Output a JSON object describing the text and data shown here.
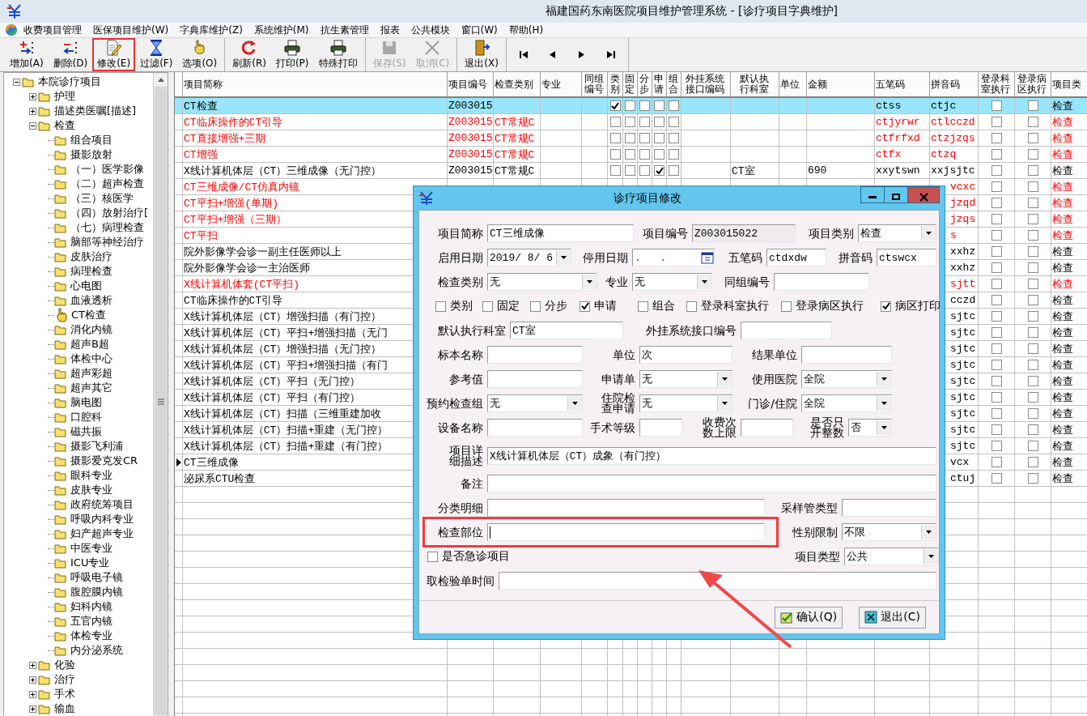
{
  "window": {
    "title": "福建国药东南医院项目维护管理系统 - [诊疗项目字典维护]"
  },
  "menu": [
    "收费项目管理",
    "医保项目维护(W)",
    "字典库维护(Z)",
    "系统维护(M)",
    "抗生素管理",
    "报表",
    "公共模块",
    "窗口(W)",
    "帮助(H)"
  ],
  "toolbar": {
    "groups": [
      [
        {
          "label": "增加(A)",
          "disabled": false,
          "annotated": false
        },
        {
          "label": "删除(D)",
          "disabled": false,
          "annotated": false
        },
        {
          "label": "修改(E)",
          "disabled": false,
          "annotated": true
        },
        {
          "label": "过滤(F)",
          "disabled": false,
          "annotated": false
        },
        {
          "label": "选项(O)",
          "disabled": false,
          "annotated": false
        }
      ],
      [
        {
          "label": "刷新(R)",
          "disabled": false,
          "annotated": false
        },
        {
          "label": "打印(P)",
          "disabled": false,
          "annotated": false
        },
        {
          "label": "特殊打印",
          "disabled": false,
          "annotated": false
        }
      ],
      [
        {
          "label": "保存(S)",
          "disabled": true,
          "annotated": false
        },
        {
          "label": "取消(C)",
          "disabled": true,
          "annotated": false
        }
      ],
      [
        {
          "label": "退出(X)",
          "disabled": false,
          "annotated": false
        }
      ]
    ]
  },
  "tree": {
    "label": "本院诊疗项目",
    "expanded": true,
    "children": [
      {
        "label": "护理",
        "expanded": false
      },
      {
        "label": "描述类医嘱[描述]",
        "expanded": false
      },
      {
        "label": "检查",
        "expanded": true,
        "children": [
          {
            "label": "组合项目",
            "selected": false
          },
          {
            "label": "摄影放射",
            "selected": false
          },
          {
            "label": "（一）医学影像",
            "selected": false
          },
          {
            "label": "（二）超声检查",
            "selected": false
          },
          {
            "label": "（三）核医学",
            "selected": false
          },
          {
            "label": "（四）放射治疗[",
            "selected": false
          },
          {
            "label": "（七）病理检查",
            "selected": false
          },
          {
            "label": "脑部等神经治疗",
            "selected": false
          },
          {
            "label": "皮肤治疗",
            "selected": false
          },
          {
            "label": "病理检查",
            "selected": false
          },
          {
            "label": "心电图",
            "selected": false
          },
          {
            "label": "血液透析",
            "selected": false
          },
          {
            "label": "CT检查",
            "selected": true
          },
          {
            "label": "消化内镜",
            "selected": false
          },
          {
            "label": "超声B超",
            "selected": false
          },
          {
            "label": "体检中心",
            "selected": false
          },
          {
            "label": "超声彩超",
            "selected": false
          },
          {
            "label": "超声其它",
            "selected": false
          },
          {
            "label": "脑电图",
            "selected": false
          },
          {
            "label": "口腔科",
            "selected": false
          },
          {
            "label": "磁共振",
            "selected": false
          },
          {
            "label": "摄影飞利浦",
            "selected": false
          },
          {
            "label": "摄影爱克发CR",
            "selected": false
          },
          {
            "label": "眼科专业",
            "selected": false
          },
          {
            "label": "皮肤专业",
            "selected": false
          },
          {
            "label": "政府统筹项目",
            "selected": false
          },
          {
            "label": "呼吸内科专业",
            "selected": false
          },
          {
            "label": "妇产超声专业",
            "selected": false
          },
          {
            "label": "中医专业",
            "selected": false
          },
          {
            "label": "ICU专业",
            "selected": false
          },
          {
            "label": "呼吸电子镜",
            "selected": false
          },
          {
            "label": "腹腔膜内镜",
            "selected": false
          },
          {
            "label": "妇科内镜",
            "selected": false
          },
          {
            "label": "五官内镜",
            "selected": false
          },
          {
            "label": "体检专业",
            "selected": false
          },
          {
            "label": "内分泌系统",
            "selected": false
          }
        ]
      },
      {
        "label": "化验",
        "expanded": false
      },
      {
        "label": "治疗",
        "expanded": false
      },
      {
        "label": "手术",
        "expanded": false
      },
      {
        "label": "输血",
        "expanded": false
      }
    ]
  },
  "grid": {
    "columns": [
      "项目简称",
      "项目编号",
      "检查类别",
      "专业",
      "同组编号",
      "类别",
      "固定",
      "分步",
      "申请",
      "组合",
      "外挂系统接口编码",
      "默认执行科室",
      "单位",
      "金额",
      "五笔码",
      "拼音码",
      "登录科室执行",
      "登录病区执行",
      "项目类"
    ],
    "rows": [
      {
        "name": "CT检查",
        "code": "Z003015",
        "flags": [
          true,
          false,
          false,
          false,
          false
        ],
        "wubi": "ctss",
        "pinyin": "ctjc",
        "dept_exec": false,
        "ward_exec": false,
        "category": "检查",
        "emphasized": false,
        "selected": true,
        "current": false
      },
      {
        "name": "CT临床操作的CT引导",
        "code": "Z003015",
        "exam_type": "CT常规C",
        "flags": [
          false,
          false,
          false,
          false,
          false
        ],
        "wubi": "ctjyrwr",
        "pinyin": "ctlcczd",
        "dept_exec": false,
        "ward_exec": false,
        "category": "检查",
        "emphasized": true,
        "selected": false,
        "current": false
      },
      {
        "name": "CT直接增强+三期",
        "code": "Z003015",
        "exam_type": "CT常规C",
        "flags": [
          false,
          false,
          false,
          false,
          false
        ],
        "wubi": "ctfrfxd",
        "pinyin": "ctzjzqs",
        "dept_exec": false,
        "ward_exec": false,
        "category": "检查",
        "emphasized": true,
        "selected": false,
        "current": false
      },
      {
        "name": "CT增强",
        "code": "Z003015",
        "exam_type": "CT常规C",
        "flags": [
          false,
          false,
          false,
          false,
          false
        ],
        "wubi": "ctfx",
        "pinyin": "ctzq",
        "dept_exec": false,
        "ward_exec": false,
        "category": "检查",
        "emphasized": true,
        "selected": false,
        "current": false
      },
      {
        "name": "X线计算机体层（CT）三维成像（无门控）",
        "code": "Z003015",
        "exam_type": "CT常规C",
        "flags": [
          false,
          false,
          false,
          true,
          false
        ],
        "exec_dept": "CT室",
        "amount": "690",
        "wubi": "xxytswn",
        "pinyin": "xxjsjtc",
        "dept_exec": false,
        "ward_exec": false,
        "category": "检查",
        "emphasized": false,
        "selected": false,
        "current": false
      },
      {
        "name": "CT三维成像/CT仿真内镜",
        "pinyin_tail": "vcxc",
        "dept_exec": false,
        "ward_exec": false,
        "category": "检查",
        "emphasized": true,
        "selected": false,
        "current": false
      },
      {
        "name": "CT平扫+增强(单期)",
        "pinyin_tail": "jzqd",
        "dept_exec": false,
        "ward_exec": false,
        "category": "检查",
        "emphasized": true,
        "selected": false,
        "current": false
      },
      {
        "name": "CT平扫+增强（三期）",
        "pinyin_tail": "jzqs",
        "dept_exec": false,
        "ward_exec": false,
        "category": "检查",
        "emphasized": true,
        "selected": false,
        "current": false
      },
      {
        "name": "CT平扫",
        "pinyin_tail": "s",
        "dept_exec": false,
        "ward_exec": false,
        "category": "检查",
        "emphasized": true,
        "selected": false,
        "current": false
      },
      {
        "name": "院外影像学会诊一副主任医师以上",
        "pinyin_tail": "xxhz",
        "dept_exec": false,
        "ward_exec": false,
        "category": "检查",
        "emphasized": false,
        "selected": false,
        "current": false
      },
      {
        "name": "院外影像学会诊一主治医师",
        "pinyin_tail": "xxhz",
        "dept_exec": false,
        "ward_exec": false,
        "category": "检查",
        "emphasized": false,
        "selected": false,
        "current": false
      },
      {
        "name": "X线计算机体套(CT平扫)",
        "pinyin_tail": "sjtt",
        "dept_exec": false,
        "ward_exec": false,
        "category": "检查",
        "emphasized": true,
        "selected": false,
        "current": false
      },
      {
        "name": "CT临床操作的CT引导",
        "pinyin_tail": "cczd",
        "dept_exec": false,
        "ward_exec": false,
        "category": "检查",
        "emphasized": false,
        "selected": false,
        "current": false
      },
      {
        "name": "X线计算机体层（CT）增强扫描（有门控）",
        "pinyin_tail": "sjtc",
        "dept_exec": false,
        "ward_exec": false,
        "category": "检查",
        "emphasized": false,
        "selected": false,
        "current": false
      },
      {
        "name": "X线计算机体层（CT）平扫+增强扫描（无门",
        "pinyin_tail": "sjtc",
        "dept_exec": false,
        "ward_exec": false,
        "category": "检查",
        "emphasized": false,
        "selected": false,
        "current": false
      },
      {
        "name": "X线计算机体层（CT）增强扫描（无门控）",
        "pinyin_tail": "sjtc",
        "dept_exec": false,
        "ward_exec": false,
        "category": "检查",
        "emphasized": false,
        "selected": false,
        "current": false
      },
      {
        "name": "X线计算机体层（CT）平扫+增强扫描（有门",
        "pinyin_tail": "sjtc",
        "dept_exec": false,
        "ward_exec": false,
        "category": "检查",
        "emphasized": false,
        "selected": false,
        "current": false
      },
      {
        "name": "X线计算机体层（CT）平扫（无门控）",
        "pinyin_tail": "sjtc",
        "dept_exec": false,
        "ward_exec": false,
        "category": "检查",
        "emphasized": false,
        "selected": false,
        "current": false
      },
      {
        "name": "X线计算机体层（CT）平扫（有门控）",
        "pinyin_tail": "sjtc",
        "dept_exec": false,
        "ward_exec": false,
        "category": "检查",
        "emphasized": false,
        "selected": false,
        "current": false
      },
      {
        "name": "X线计算机体层（CT）扫描（三维重建加收",
        "pinyin_tail": "sjtc",
        "dept_exec": false,
        "ward_exec": false,
        "category": "检查",
        "emphasized": false,
        "selected": false,
        "current": false
      },
      {
        "name": "X线计算机体层（CT）扫描+重建（无门控）",
        "pinyin_tail": "sjtc",
        "dept_exec": false,
        "ward_exec": false,
        "category": "检查",
        "emphasized": false,
        "selected": false,
        "current": false
      },
      {
        "name": "X线计算机体层（CT）扫描+重建（有门控）",
        "pinyin_tail": "sjtc",
        "dept_exec": false,
        "ward_exec": false,
        "category": "检查",
        "emphasized": false,
        "selected": false,
        "current": false
      },
      {
        "name": "CT三维成像",
        "pinyin_tail": "vcx",
        "dept_exec": false,
        "ward_exec": false,
        "category": "检查",
        "emphasized": false,
        "selected": false,
        "current": true
      },
      {
        "name": "泌尿系CTU检查",
        "pinyin_tail": "ctuj",
        "dept_exec": false,
        "ward_exec": false,
        "category": "检查",
        "emphasized": false,
        "selected": false,
        "current": false
      }
    ]
  },
  "dialog": {
    "title": "诊疗项目修改",
    "rows": [
      [
        {
          "label": "项目简称",
          "kind": "text",
          "value": "CT三维成像"
        },
        {
          "label": "项目编号",
          "kind": "readonly",
          "value": "Z003015022"
        },
        {
          "label": "项目类别",
          "kind": "combo",
          "value": "检查"
        }
      ],
      [
        {
          "label": "启用日期",
          "kind": "date-combo",
          "value": "2019/ 8/ 6"
        },
        {
          "label": "停用日期",
          "kind": "date-calendar",
          "value": ".   ."
        },
        {
          "label": "五笔码",
          "kind": "text",
          "value": "ctdxdw"
        },
        {
          "label": "拼音码",
          "kind": "text",
          "value": "ctswcx"
        }
      ],
      [
        {
          "label": "检查类别",
          "kind": "combo",
          "value": "无"
        },
        {
          "label": "专业",
          "kind": "combo",
          "value": "无"
        },
        {
          "label": "同组编号",
          "kind": "text"
        }
      ],
      [
        {
          "label": "类别",
          "kind": "checkbox",
          "checked": false
        },
        {
          "label": "固定",
          "kind": "checkbox",
          "checked": false
        },
        {
          "label": "分步",
          "kind": "checkbox",
          "checked": false
        },
        {
          "label": "申请",
          "kind": "checkbox",
          "checked": true
        },
        {
          "label": "组合",
          "kind": "checkbox",
          "checked": false
        },
        {
          "label": "登录科室执行",
          "kind": "checkbox",
          "checked": false
        },
        {
          "label": "登录病区执行",
          "kind": "checkbox",
          "checked": false
        },
        {
          "label": "病区打印",
          "kind": "checkbox",
          "checked": true
        }
      ],
      [
        {
          "label": "默认执行科室",
          "kind": "text",
          "value": "CT室"
        },
        {
          "label": "外挂系统接口编号",
          "kind": "text"
        }
      ],
      [
        {
          "label": "标本名称",
          "kind": "text"
        },
        {
          "label": "单位",
          "kind": "text",
          "value": "次"
        },
        {
          "label": "结果单位",
          "kind": "text"
        }
      ],
      [
        {
          "label": "参考值",
          "kind": "text"
        },
        {
          "label": "申请单",
          "kind": "combo",
          "value": "无"
        },
        {
          "label": "使用医院",
          "kind": "combo",
          "value": "全院"
        }
      ],
      [
        {
          "label": "预约检查组",
          "kind": "combo",
          "value": "无"
        },
        {
          "label": "住院检查申请",
          "kind": "combo",
          "value": "无"
        },
        {
          "label": "门诊/住院",
          "kind": "combo",
          "value": "全院"
        }
      ],
      [
        {
          "label": "设备名称",
          "kind": "text"
        },
        {
          "label": "手术等级",
          "kind": "text"
        },
        {
          "label": "收费次数上限",
          "kind": "text"
        },
        {
          "label": "是否只开整数",
          "kind": "combo",
          "value": "否"
        }
      ],
      [
        {
          "label": "项目详细描述",
          "kind": "text",
          "value": "X线计算机体层（CT）成象（有门控）"
        }
      ],
      [
        {
          "label": "备注",
          "kind": "text"
        }
      ],
      [
        {
          "label": "分类明细",
          "kind": "text"
        },
        {
          "label": "采样管类型",
          "kind": "text"
        }
      ],
      [
        {
          "label": "检查部位",
          "kind": "text",
          "annotated": true,
          "focused": true
        },
        {
          "label": "性别限制",
          "kind": "combo",
          "value": "不限",
          "annotated": false,
          "focused": false
        }
      ],
      [
        {
          "label": "是否急诊项目",
          "kind": "checkbox",
          "checked": false
        },
        {
          "label": "项目类型",
          "kind": "combo",
          "value": "公共"
        }
      ],
      [
        {
          "label": "取检验单时间",
          "kind": "text"
        }
      ]
    ],
    "buttons": [
      "确认(Q)",
      "退出(C)"
    ]
  }
}
